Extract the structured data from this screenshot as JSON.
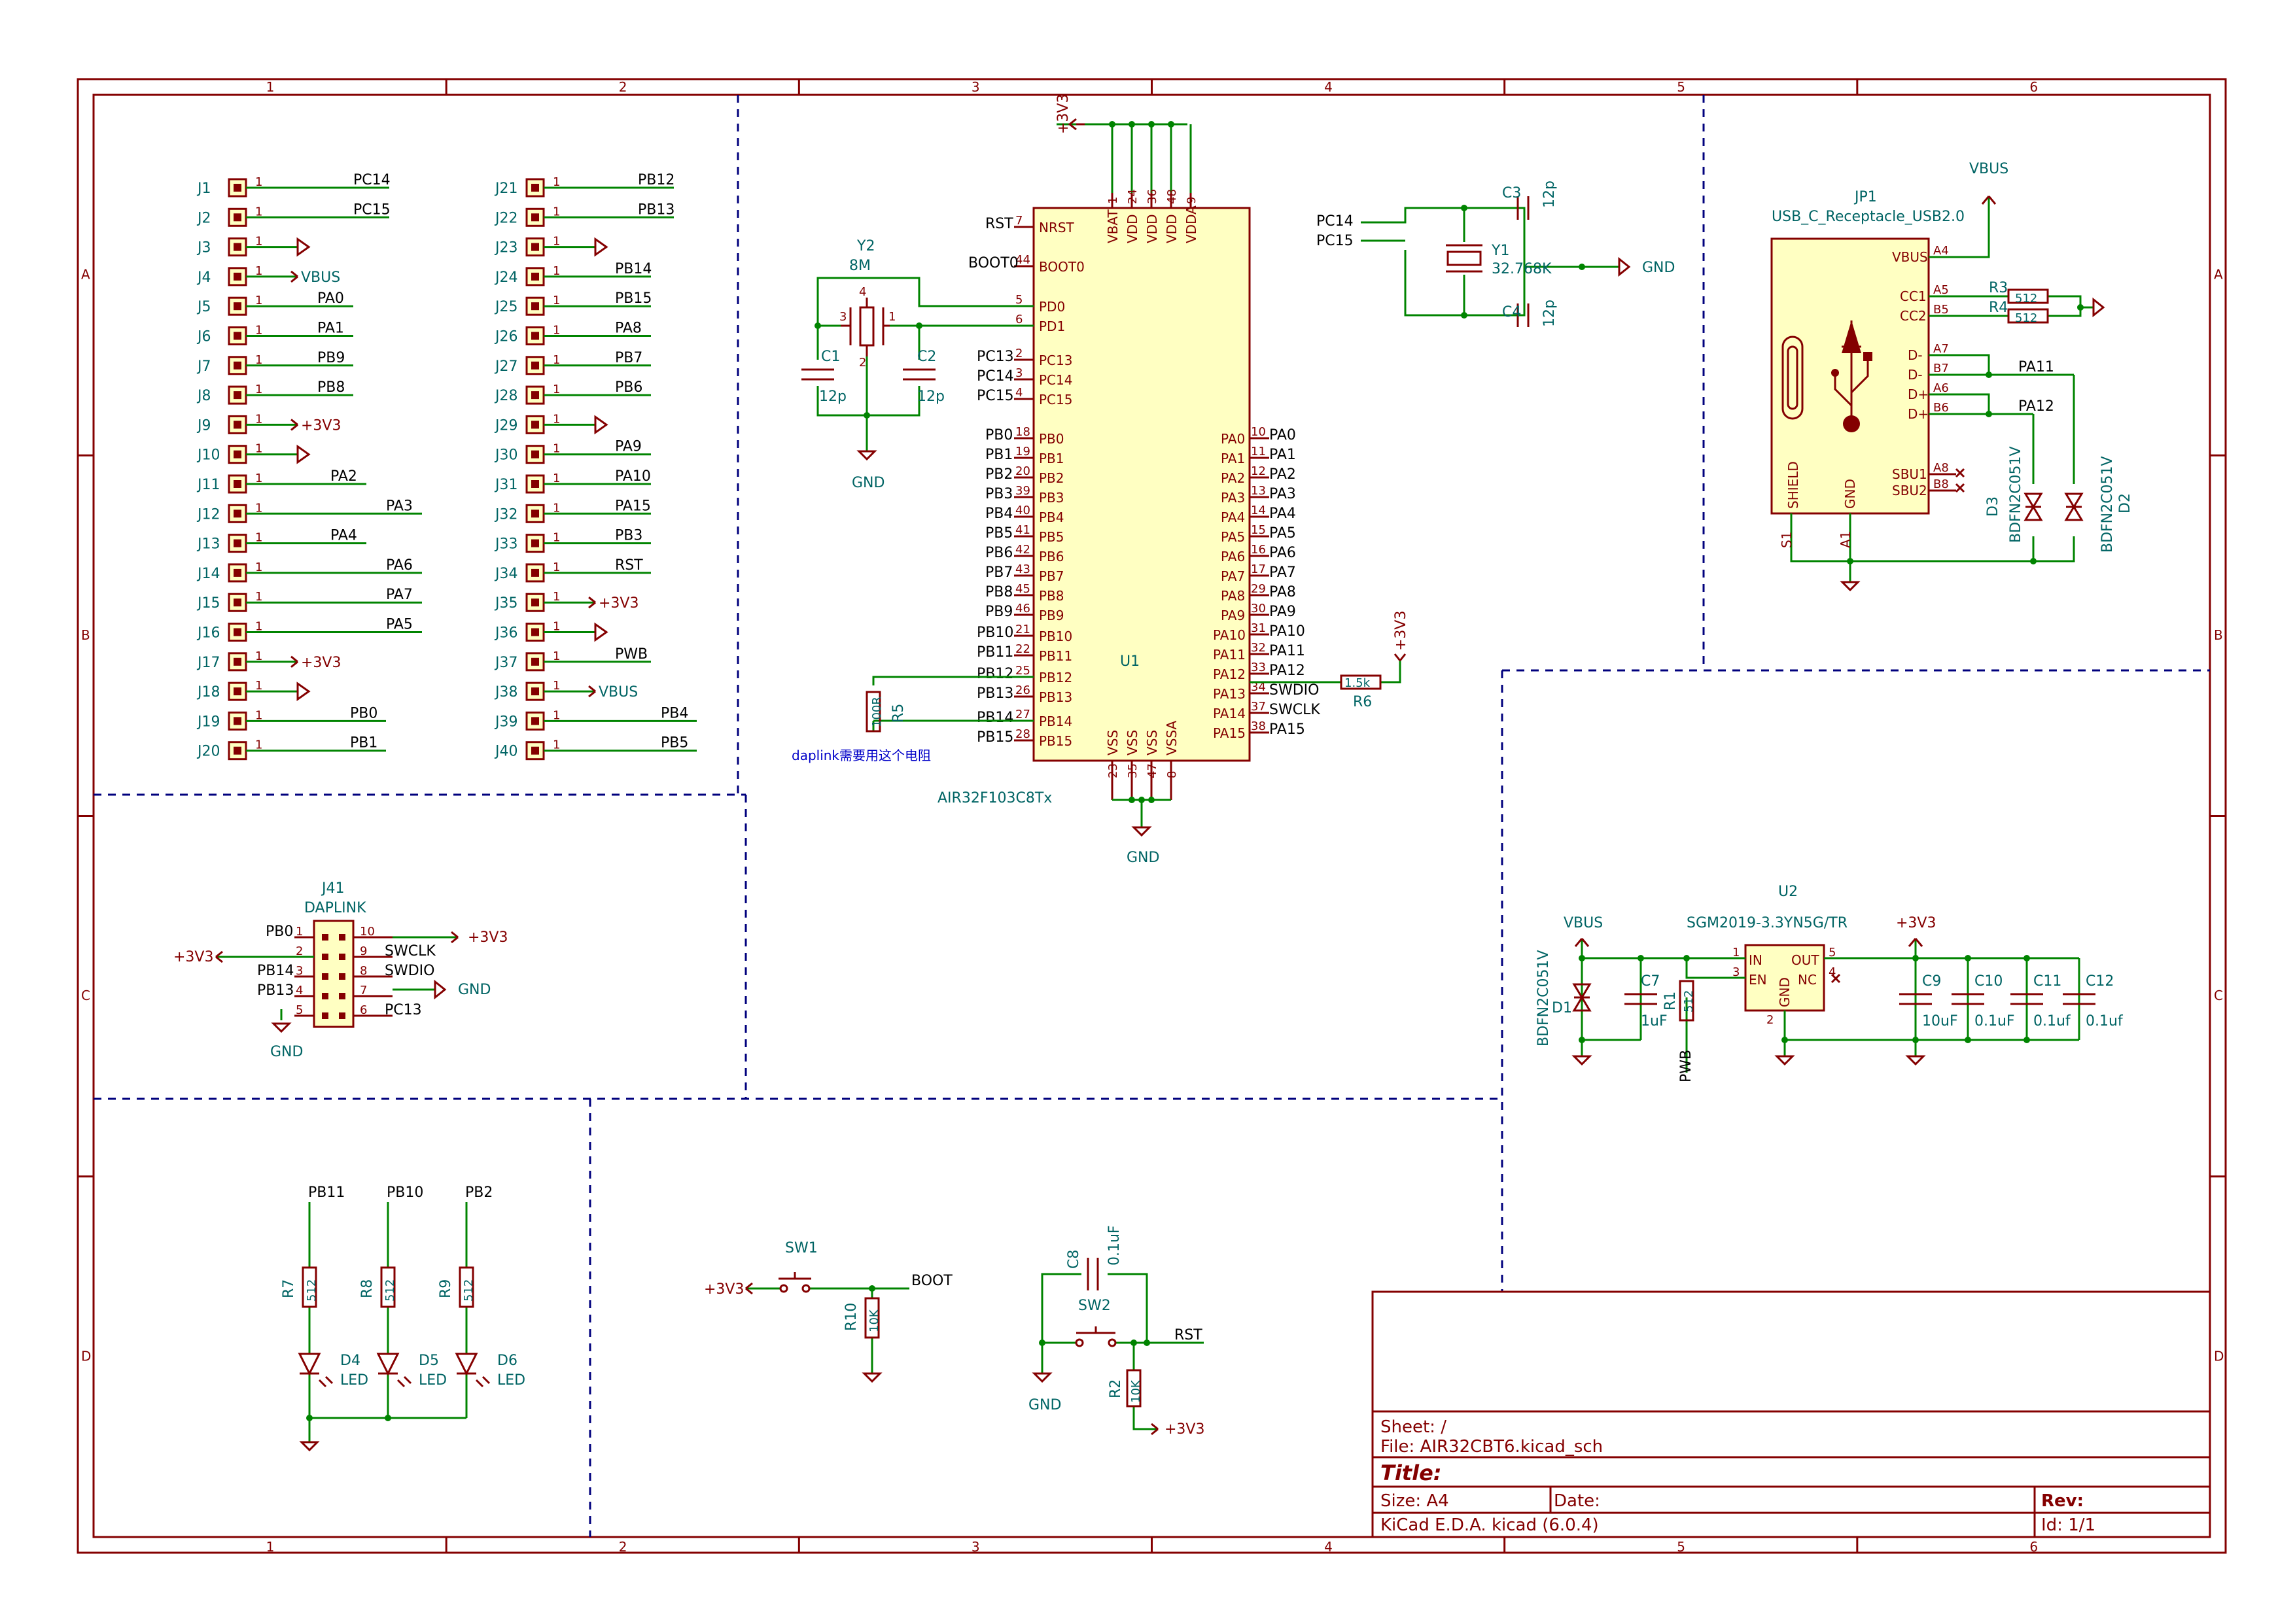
{
  "frame": {
    "columns": [
      "1",
      "2",
      "3",
      "4",
      "5",
      "6"
    ],
    "rows": [
      "A",
      "B",
      "C",
      "D"
    ]
  },
  "title_block": {
    "sheet": "Sheet: /",
    "file": "File: AIR32CBT6.kicad_sch",
    "title": "Title:",
    "size": "Size: A4",
    "date": "Date:",
    "rev": "Rev:",
    "tool": "KiCad E.D.A.  kicad (6.0.4)",
    "id": "Id: 1/1"
  },
  "headers_left": [
    {
      "ref": "J1",
      "net": "PC14"
    },
    {
      "ref": "J2",
      "net": "PC15"
    },
    {
      "ref": "J3",
      "net": ""
    },
    {
      "ref": "J4",
      "net": "VBUS"
    },
    {
      "ref": "J5",
      "net": "PA0"
    },
    {
      "ref": "J6",
      "net": "PA1"
    },
    {
      "ref": "J7",
      "net": "PB9"
    },
    {
      "ref": "J8",
      "net": "PB8"
    },
    {
      "ref": "J9",
      "net": "+3V3"
    },
    {
      "ref": "J10",
      "net": ""
    },
    {
      "ref": "J11",
      "net": "PA2"
    },
    {
      "ref": "J12",
      "net": "PA3"
    },
    {
      "ref": "J13",
      "net": "PA4"
    },
    {
      "ref": "J14",
      "net": "PA6"
    },
    {
      "ref": "J15",
      "net": "PA7"
    },
    {
      "ref": "J16",
      "net": "PA5"
    },
    {
      "ref": "J17",
      "net": "+3V3"
    },
    {
      "ref": "J18",
      "net": ""
    },
    {
      "ref": "J19",
      "net": "PB0"
    },
    {
      "ref": "J20",
      "net": "PB1"
    }
  ],
  "headers_right": [
    {
      "ref": "J21",
      "net": "PB12"
    },
    {
      "ref": "J22",
      "net": "PB13"
    },
    {
      "ref": "J23",
      "net": ""
    },
    {
      "ref": "J24",
      "net": "PB14"
    },
    {
      "ref": "J25",
      "net": "PB15"
    },
    {
      "ref": "J26",
      "net": "PA8"
    },
    {
      "ref": "J27",
      "net": "PB7"
    },
    {
      "ref": "J28",
      "net": "PB6"
    },
    {
      "ref": "J29",
      "net": ""
    },
    {
      "ref": "J30",
      "net": "PA9"
    },
    {
      "ref": "J31",
      "net": "PA10"
    },
    {
      "ref": "J32",
      "net": "PA15"
    },
    {
      "ref": "J33",
      "net": "PB3"
    },
    {
      "ref": "J34",
      "net": "RST"
    },
    {
      "ref": "J35",
      "net": "+3V3"
    },
    {
      "ref": "J36",
      "net": ""
    },
    {
      "ref": "J37",
      "net": "PWB"
    },
    {
      "ref": "J38",
      "net": "VBUS"
    },
    {
      "ref": "J39",
      "net": "PB4"
    },
    {
      "ref": "J40",
      "net": "PB5"
    }
  ],
  "pin_one": "1",
  "mcu": {
    "ref": "U1",
    "value": "AIR32F103C8Tx",
    "top_pins": [
      {
        "num": "1",
        "name": "VBAT"
      },
      {
        "num": "24",
        "name": "VDD"
      },
      {
        "num": "36",
        "name": "VDD"
      },
      {
        "num": "48",
        "name": "VDD"
      },
      {
        "num": "9",
        "name": "VDDA"
      }
    ],
    "bottom_pins": [
      {
        "num": "23",
        "name": "VSS"
      },
      {
        "num": "35",
        "name": "VSS"
      },
      {
        "num": "47",
        "name": "VSS"
      },
      {
        "num": "8",
        "name": "VSSA"
      }
    ],
    "left_pins": [
      {
        "net": "RST",
        "num": "7",
        "name": "NRST"
      },
      {
        "net": "BOOT0",
        "num": "44",
        "name": "BOOT0"
      },
      {
        "net": "",
        "num": "5",
        "name": "PD0"
      },
      {
        "net": "",
        "num": "6",
        "name": "PD1"
      },
      {
        "net": "PC13",
        "num": "2",
        "name": "PC13"
      },
      {
        "net": "PC14",
        "num": "3",
        "name": "PC14"
      },
      {
        "net": "PC15",
        "num": "4",
        "name": "PC15"
      },
      {
        "net": "PB0",
        "num": "18",
        "name": "PB0"
      },
      {
        "net": "PB1",
        "num": "19",
        "name": "PB1"
      },
      {
        "net": "PB2",
        "num": "20",
        "name": "PB2"
      },
      {
        "net": "PB3",
        "num": "39",
        "name": "PB3"
      },
      {
        "net": "PB4",
        "num": "40",
        "name": "PB4"
      },
      {
        "net": "PB5",
        "num": "41",
        "name": "PB5"
      },
      {
        "net": "PB6",
        "num": "42",
        "name": "PB6"
      },
      {
        "net": "PB7",
        "num": "43",
        "name": "PB7"
      },
      {
        "net": "PB8",
        "num": "45",
        "name": "PB8"
      },
      {
        "net": "PB9",
        "num": "46",
        "name": "PB9"
      },
      {
        "net": "PB10",
        "num": "21",
        "name": "PB10"
      },
      {
        "net": "PB11",
        "num": "22",
        "name": "PB11"
      },
      {
        "net": "PB12",
        "num": "25",
        "name": "PB12"
      },
      {
        "net": "PB13",
        "num": "26",
        "name": "PB13"
      },
      {
        "net": "PB14",
        "num": "27",
        "name": "PB14"
      },
      {
        "net": "PB15",
        "num": "28",
        "name": "PB15"
      }
    ],
    "right_pins": [
      {
        "name": "PA0",
        "num": "10",
        "net": "PA0"
      },
      {
        "name": "PA1",
        "num": "11",
        "net": "PA1"
      },
      {
        "name": "PA2",
        "num": "12",
        "net": "PA2"
      },
      {
        "name": "PA3",
        "num": "13",
        "net": "PA3"
      },
      {
        "name": "PA4",
        "num": "14",
        "net": "PA4"
      },
      {
        "name": "PA5",
        "num": "15",
        "net": "PA5"
      },
      {
        "name": "PA6",
        "num": "16",
        "net": "PA6"
      },
      {
        "name": "PA7",
        "num": "17",
        "net": "PA7"
      },
      {
        "name": "PA8",
        "num": "29",
        "net": "PA8"
      },
      {
        "name": "PA9",
        "num": "30",
        "net": "PA9"
      },
      {
        "name": "PA10",
        "num": "31",
        "net": "PA10"
      },
      {
        "name": "PA11",
        "num": "32",
        "net": "PA11"
      },
      {
        "name": "PA12",
        "num": "33",
        "net": "PA12"
      },
      {
        "name": "PA13",
        "num": "34",
        "net": "SWDIO"
      },
      {
        "name": "PA14",
        "num": "37",
        "net": "SWCLK"
      },
      {
        "name": "PA15",
        "num": "38",
        "net": "PA15"
      }
    ]
  },
  "power": {
    "p3v3": "+3V3",
    "gnd": "GND",
    "vbus": "VBUS"
  },
  "crystal_hf": {
    "ref": "Y2",
    "value": "8M",
    "c1": "C1",
    "c1v": "12p",
    "c2": "C2",
    "c2v": "12p",
    "p1": "1",
    "p2": "2",
    "p3": "3",
    "p4": "4"
  },
  "crystal_lf": {
    "ref": "Y1",
    "value": "32.768K",
    "n1": "PC14",
    "n2": "PC15",
    "c3": "C3",
    "c3v": "12p",
    "c4": "C4",
    "c4v": "12p"
  },
  "r5": {
    "ref": "R5",
    "value": "100R",
    "note": "daplink需要用这个电阻"
  },
  "r6": {
    "ref": "R6",
    "value": "1.5k"
  },
  "usb": {
    "ref": "JP1",
    "value": "USB_C_Receptacle_USB2.0",
    "pins": [
      {
        "name": "VBUS",
        "num": "A4"
      },
      {
        "name": "CC1",
        "num": "A5"
      },
      {
        "name": "CC2",
        "num": "B5"
      },
      {
        "name": "D-",
        "num": "A7"
      },
      {
        "name": "D-",
        "num": "B7"
      },
      {
        "name": "D+",
        "num": "A6"
      },
      {
        "name": "D+",
        "num": "B6"
      },
      {
        "name": "SBU1",
        "num": "A8"
      },
      {
        "name": "SBU2",
        "num": "B8"
      }
    ],
    "shield": "SHIELD",
    "gnd": "GND",
    "s1": "S1",
    "a1": "A1",
    "pa11": "PA11",
    "pa12": "PA12",
    "r3": "R3",
    "r4": "R4",
    "r3v": "512",
    "r4v": "512",
    "d3": "D3",
    "d2": "D2",
    "dval": "BDFN2C051V"
  },
  "daplink": {
    "ref": "J41",
    "value": "DAPLINK",
    "rows": [
      {
        "ln": "PB0",
        "lnum": "1",
        "rnum": "10",
        "rn": "+3V3"
      },
      {
        "ln": "",
        "lnum": "2",
        "rnum": "9",
        "rn": "SWCLK"
      },
      {
        "ln": "PB14",
        "lnum": "3",
        "rnum": "8",
        "rn": "SWDIO"
      },
      {
        "ln": "PB13",
        "lnum": "4",
        "rnum": "7",
        "rn": ""
      },
      {
        "ln": "",
        "lnum": "5",
        "rnum": "6",
        "rn": "PC13"
      }
    ]
  },
  "ldo": {
    "ref": "U2",
    "value": "SGM2019-3.3YN5G/TR",
    "in": "IN",
    "en": "EN",
    "out": "OUT",
    "nc": "NC",
    "gnd": "GND",
    "p1": "1",
    "p3": "3",
    "p5": "5",
    "p4": "4",
    "p2": "2",
    "d1": "D1",
    "d1v": "BDFN2C051V",
    "c7": "C7",
    "c7v": "1uF",
    "r1": "R1",
    "r1v": "512",
    "pwb": "PWB",
    "caps": [
      {
        "ref": "C9",
        "val": "10uF"
      },
      {
        "ref": "C10",
        "val": "0.1uF"
      },
      {
        "ref": "C11",
        "val": "0.1uf"
      },
      {
        "ref": "C12",
        "val": "0.1uf"
      }
    ]
  },
  "leds": [
    {
      "net": "PB11",
      "r": "R7",
      "rv": "512",
      "d": "D4",
      "dv": "LED"
    },
    {
      "net": "PB10",
      "r": "R8",
      "rv": "512",
      "d": "D5",
      "dv": "LED"
    },
    {
      "net": "PB2",
      "r": "R9",
      "rv": "512",
      "d": "D6",
      "dv": "LED"
    }
  ],
  "boot": {
    "sw": "SW1",
    "r": "R10",
    "rv": "10K",
    "net": "BOOT"
  },
  "reset": {
    "sw": "SW2",
    "c": "C8",
    "cv": "0.1uF",
    "r": "R2",
    "rv": "10K",
    "net": "RST"
  }
}
